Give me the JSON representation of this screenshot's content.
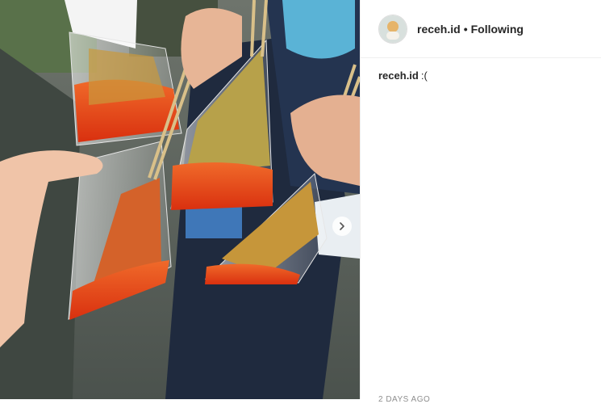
{
  "post": {
    "username": "receh.id",
    "separator": "•",
    "follow_status": "Following",
    "caption": {
      "username": "receh.id",
      "text": ":("
    },
    "timestamp": "2 DAYS AGO"
  },
  "media": {
    "description_icon": "photo-icon",
    "next_icon": "chevron-right-icon"
  },
  "colors": {
    "link": "#262626",
    "muted": "#8e8e8e",
    "sauce": "#e8421b"
  }
}
